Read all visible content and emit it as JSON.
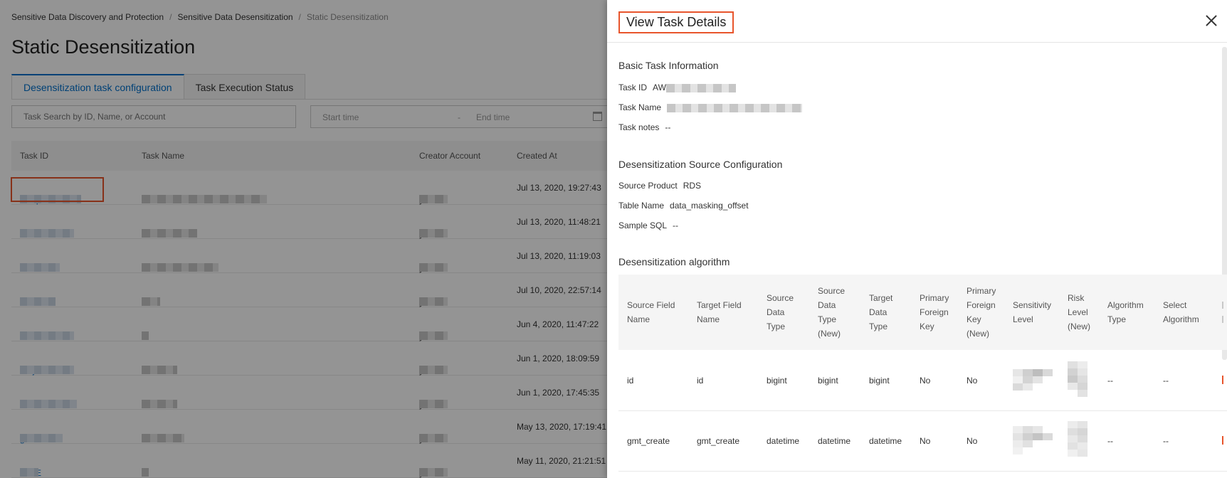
{
  "breadcrumb": [
    "Sensitive Data Discovery and Protection",
    "Sensitive Data Desensitization",
    "Static Desensitization"
  ],
  "page_title": "Static Desensitization",
  "tabs": [
    {
      "label": "Desensitization task configuration",
      "active": true
    },
    {
      "label": "Task Execution Status",
      "active": false
    }
  ],
  "search": {
    "placeholder": "Task Search by ID, Name, or Account"
  },
  "date_range": {
    "start_placeholder": "Start time",
    "separator": "-",
    "end_placeholder": "End time"
  },
  "task_table": {
    "headers": [
      "Task ID",
      "Task Name",
      "Creator Account",
      "Created At"
    ],
    "rows": [
      {
        "id": "AWqw",
        "creator": "yu",
        "created": "Jul 13, 2020, 19:27:43"
      },
      {
        "id": "G1bEf",
        "creator": "yu",
        "created": "Jul 13, 2020, 11:48:21"
      },
      {
        "id": "JUFL",
        "creator": "yu",
        "created": "Jul 13, 2020, 11:19:03"
      },
      {
        "id": "fk4G",
        "creator": "yu",
        "created": "Jul 10, 2020, 22:57:14"
      },
      {
        "id": "23V",
        "creator": "yu",
        "created": "Jun 4, 2020, 11:47:22"
      },
      {
        "id": "rdFjN",
        "creator": "yu",
        "created": "Jun 1, 2020, 18:09:59"
      },
      {
        "id": "ODIC",
        "creator": "yu",
        "created": "Jun 1, 2020, 17:45:35"
      },
      {
        "id": "gdm",
        "creator": "yu",
        "created": "May 13, 2020, 17:19:41"
      },
      {
        "id": "n9DE",
        "creator": "yu",
        "created": "May 11, 2020, 21:21:51"
      }
    ]
  },
  "drawer": {
    "title": "View Task Details",
    "basic": {
      "title": "Basic Task Information",
      "task_id_label": "Task ID",
      "task_id_value": "AW",
      "task_name_label": "Task Name",
      "task_notes_label": "Task notes",
      "task_notes_value": "--"
    },
    "source": {
      "title": "Desensitization Source Configuration",
      "product_label": "Source Product",
      "product_value": "RDS",
      "table_label": "Table Name",
      "table_value": "data_masking_offset",
      "sql_label": "Sample SQL",
      "sql_value": "--"
    },
    "algorithm": {
      "title": "Desensitization algorithm",
      "headers": [
        [
          "Source Field",
          "Name"
        ],
        [
          "Target Field",
          "Name"
        ],
        [
          "Source",
          "Data",
          "Type"
        ],
        [
          "Source",
          "Data",
          "Type",
          "(New)"
        ],
        [
          "Target",
          "Data",
          "Type"
        ],
        [
          "Primary",
          "Foreign",
          "Key"
        ],
        [
          "Primary",
          "Foreign",
          "Key",
          "(New)"
        ],
        [
          "Sensitivity",
          "Level"
        ],
        [
          "Risk",
          "Level",
          "(New)"
        ],
        [
          "Algorithm",
          "Type"
        ],
        [
          "Select",
          "Algorithm"
        ]
      ],
      "rows": [
        {
          "source_field": "id",
          "target_field": "id",
          "source_type": "bigint",
          "source_type_new": "bigint",
          "target_type": "bigint",
          "pfk": "No",
          "pfk_new": "No",
          "algorithm_type": "--",
          "select_algorithm": "--"
        },
        {
          "source_field": "gmt_create",
          "target_field": "gmt_create",
          "source_type": "datetime",
          "source_type_new": "datetime",
          "target_type": "datetime",
          "pfk": "No",
          "pfk_new": "No",
          "algorithm_type": "--",
          "select_algorithm": "--"
        }
      ]
    }
  },
  "colors": {
    "accent": "#0070cc",
    "highlight": "#e8552c",
    "overlay": "rgba(0,0,0,0.42)"
  }
}
